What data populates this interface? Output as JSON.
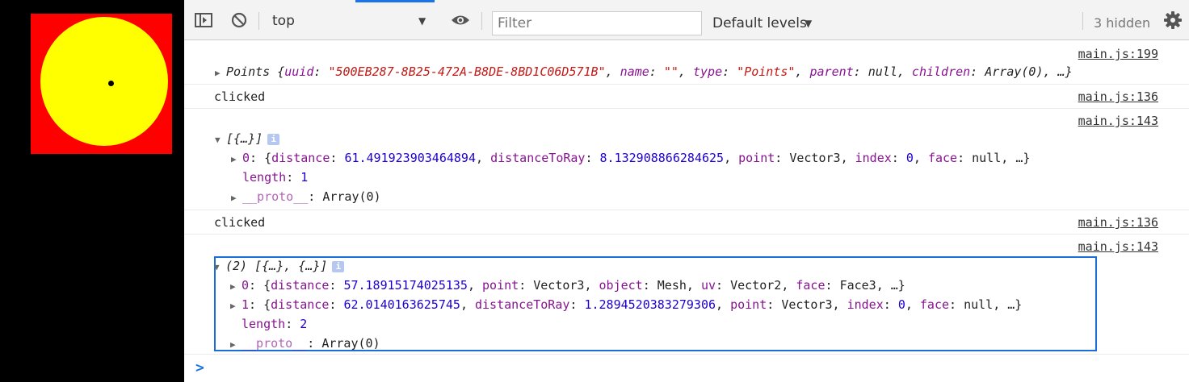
{
  "colors": {
    "canvas_bg": "#000000",
    "square": "#ff0000",
    "circle": "#ffff00",
    "dot": "#000000",
    "accent": "#1a73e8",
    "string": "#c41a16",
    "number": "#1c00cf",
    "key": "#881391"
  },
  "toolbar": {
    "sidebar_icon": "sidebar-toggle-icon",
    "clear_icon": "no-entry-icon",
    "context": "top",
    "eye_icon": "eye-icon",
    "filter_placeholder": "Filter",
    "levels": "Default levels",
    "hidden": "3 hidden",
    "settings_icon": "gear-icon"
  },
  "console": {
    "m1": {
      "source": "main.js:199",
      "prefix": "Points {",
      "k_uuid": "uuid",
      "v_uuid": "\"500EB287-8B25-472A-B8DE-8BD1C06D571B\"",
      "k_name": "name",
      "v_name": "\"\"",
      "k_type": "type",
      "v_type": "\"Points\"",
      "k_parent": "parent",
      "v_parent": "null",
      "k_children": "children",
      "v_children": "Array(0)",
      "suffix": "…}"
    },
    "m2": {
      "source": "main.js:136",
      "text": "clicked"
    },
    "m3": {
      "source": "main.js:143",
      "header": "[{…}]",
      "item0": {
        "index": "0",
        "k_distance": "distance",
        "v_distance": "61.491923903464894",
        "k_dtr": "distanceToRay",
        "v_dtr": "8.132908866284625",
        "k_point": "point",
        "v_point": "Vector3",
        "k_index": "index",
        "v_index": "0",
        "k_face": "face",
        "v_face": "null",
        "suffix": "…}"
      },
      "length_key": "length",
      "length_val": "1",
      "proto_key": "__proto__",
      "proto_val": "Array(0)"
    },
    "m4": {
      "source": "main.js:136",
      "text": "clicked"
    },
    "m5": {
      "source": "main.js:143",
      "header": "(2) [{…}, {…}]",
      "item0": {
        "index": "0",
        "k_distance": "distance",
        "v_distance": "57.18915174025135",
        "k_point": "point",
        "v_point": "Vector3",
        "k_object": "object",
        "v_object": "Mesh",
        "k_uv": "uv",
        "v_uv": "Vector2",
        "k_face": "face",
        "v_face": "Face3",
        "suffix": "…}"
      },
      "item1": {
        "index": "1",
        "k_distance": "distance",
        "v_distance": "62.0140163625745",
        "k_dtr": "distanceToRay",
        "v_dtr": "1.2894520383279306",
        "k_point": "point",
        "v_point": "Vector3",
        "k_index": "index",
        "v_index": "0",
        "k_face": "face",
        "v_face": "null",
        "suffix": "…}"
      },
      "length_key": "length",
      "length_val": "2",
      "proto_key": "__proto__",
      "proto_val": "Array(0)"
    },
    "prompt": ">"
  }
}
